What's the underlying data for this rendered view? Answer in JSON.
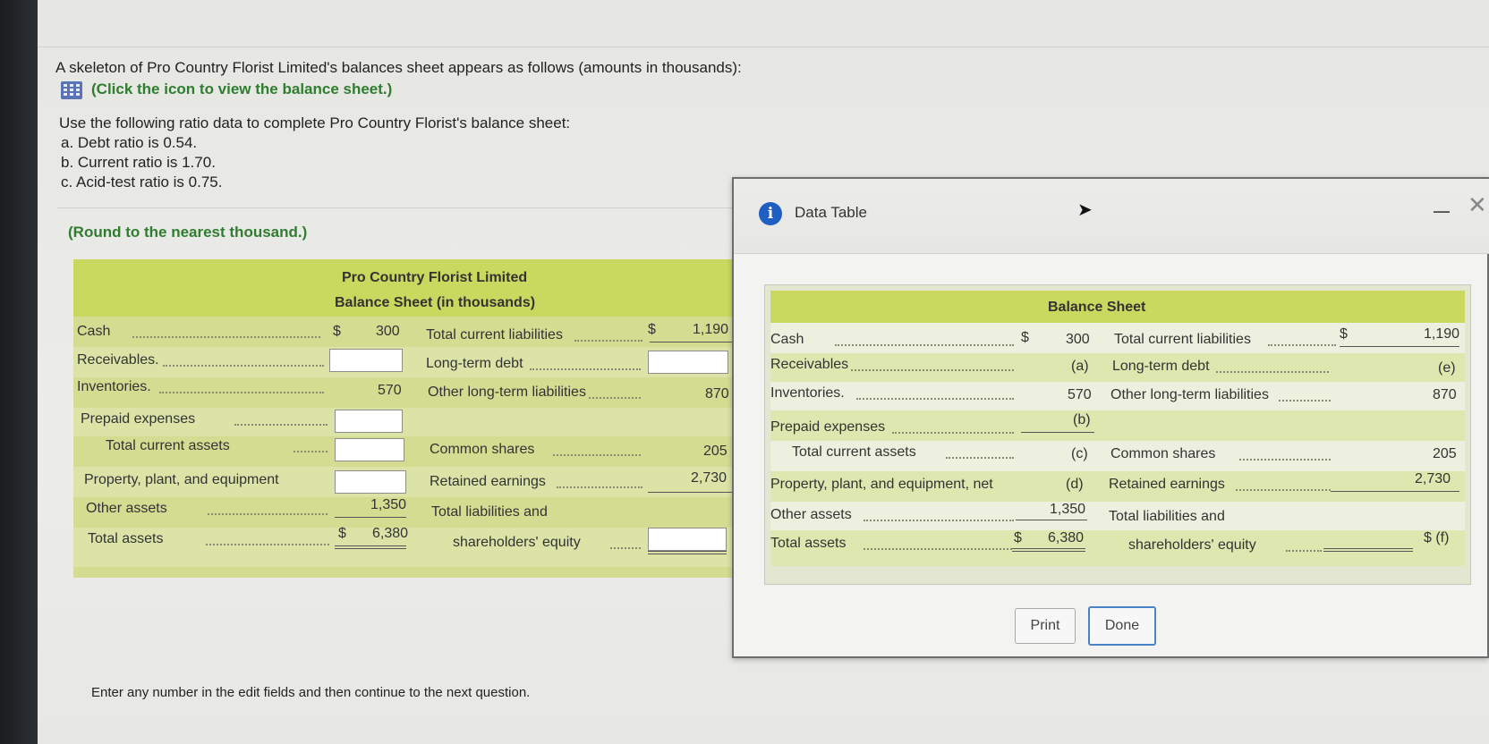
{
  "question": {
    "intro": "A skeleton of Pro Country Florist Limited's balances sheet appears as follows (amounts in thousands):",
    "link": "(Click the icon to view the balance sheet.)",
    "use_following": "Use the following ratio data to complete Pro Country Florist's balance sheet:",
    "ratio_a": "a. Debt ratio is 0.54.",
    "ratio_b": "b. Current ratio is 1.70.",
    "ratio_c": "c. Acid-test ratio is 0.75.",
    "round_note": "(Round to the nearest thousand.)",
    "footer": "Enter any number in the edit fields and then continue to the next question."
  },
  "left_sheet": {
    "company": "Pro Country Florist Limited",
    "subtitle": "Balance Sheet (in thousands)",
    "cash": "Cash",
    "dollar": "$",
    "cash_val": "300",
    "receivables": "Receivables.",
    "inventories": "Inventories.",
    "inventories_val": "570",
    "prepaid": "Prepaid expenses",
    "total_current_assets": "Total current assets",
    "ppe": "Property, plant, and equipment",
    "other_assets": "Other assets",
    "other_assets_val": "1,350",
    "total_assets": "Total assets",
    "total_assets_val": "6,380",
    "tcl": "Total current liabilities",
    "tcl_val": "1,190",
    "ltd": "Long-term debt",
    "olt": "Other long-term liabilities",
    "olt_val": "870",
    "common": "Common shares",
    "common_val": "205",
    "retained": "Retained earnings",
    "retained_val": "2,730",
    "tle1": "Total liabilities and",
    "tle2": "shareholders' equity"
  },
  "dialog": {
    "title": "Data Table",
    "info_glyph": "i",
    "minimize": "—",
    "close": "✕",
    "heading": "Balance Sheet",
    "cash": "Cash",
    "dollar": "$",
    "cash_val": "300",
    "receivables": "Receivables",
    "receivables_val": "(a)",
    "inventories": "Inventories.",
    "inventories_val": "570",
    "prepaid": "Prepaid expenses",
    "prepaid_val": "(b)",
    "tca": "Total current assets",
    "tca_val": "(c)",
    "ppe": "Property, plant, and equipment, net",
    "ppe_val": "(d)",
    "other_assets": "Other assets",
    "other_assets_val": "1,350",
    "total_assets": "Total assets",
    "total_assets_val": "6,380",
    "tcl": "Total current liabilities",
    "tcl_val": "1,190",
    "ltd": "Long-term debt",
    "ltd_val": "(e)",
    "olt": "Other long-term liabilities",
    "olt_val": "870",
    "common": "Common shares",
    "common_val": "205",
    "retained": "Retained earnings",
    "retained_val": "2,730",
    "tle1": "Total liabilities and",
    "tle2": "shareholders' equity",
    "tle_val": "$ (f)",
    "print": "Print",
    "done": "Done"
  }
}
